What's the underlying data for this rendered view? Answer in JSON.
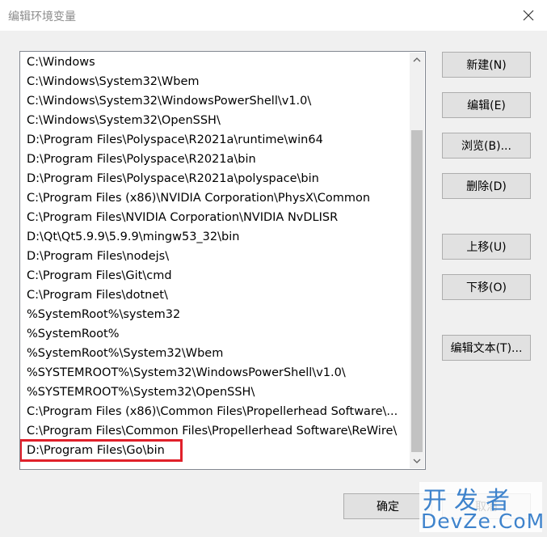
{
  "window": {
    "title": "编辑环境变量"
  },
  "paths": [
    "C:\\Windows",
    "C:\\Windows\\System32\\Wbem",
    "C:\\Windows\\System32\\WindowsPowerShell\\v1.0\\",
    "C:\\Windows\\System32\\OpenSSH\\",
    "D:\\Program Files\\Polyspace\\R2021a\\runtime\\win64",
    "D:\\Program Files\\Polyspace\\R2021a\\bin",
    "D:\\Program Files\\Polyspace\\R2021a\\polyspace\\bin",
    "C:\\Program Files (x86)\\NVIDIA Corporation\\PhysX\\Common",
    "C:\\Program Files\\NVIDIA Corporation\\NVIDIA NvDLISR",
    "D:\\Qt\\Qt5.9.9\\5.9.9\\mingw53_32\\bin",
    "D:\\Program Files\\nodejs\\",
    "C:\\Program Files\\Git\\cmd",
    "C:\\Program Files\\dotnet\\",
    "%SystemRoot%\\system32",
    "%SystemRoot%",
    "%SystemRoot%\\System32\\Wbem",
    "%SYSTEMROOT%\\System32\\WindowsPowerShell\\v1.0\\",
    "%SYSTEMROOT%\\System32\\OpenSSH\\",
    "C:\\Program Files (x86)\\Common Files\\Propellerhead Software\\...",
    "C:\\Program Files\\Common Files\\Propellerhead Software\\ReWire\\",
    "D:\\Program Files\\Go\\bin"
  ],
  "selected_index": 20,
  "buttons": {
    "new": "新建(N)",
    "edit": "编辑(E)",
    "browse": "浏览(B)...",
    "delete": "删除(D)",
    "move_up": "上移(U)",
    "move_down": "下移(O)",
    "edit_text": "编辑文本(T)...",
    "ok": "确定",
    "cancel": "取消"
  },
  "watermark": {
    "top": "开发者",
    "bottom": "DevZe.CoM"
  },
  "colors": {
    "highlight": "#e0202a",
    "watermark": "#3e83cc"
  }
}
